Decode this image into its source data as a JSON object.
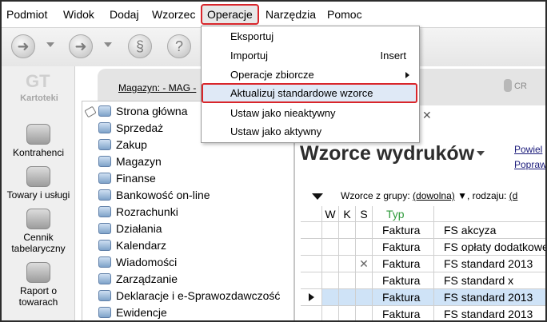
{
  "menubar": [
    "Podmiot",
    "Widok",
    "Dodaj",
    "Wzorzec",
    "Operacje",
    "Narzędzia",
    "Pomoc"
  ],
  "active_menu": "Operacje",
  "operacje_menu": [
    {
      "label": "Eksportuj",
      "shortcut": ""
    },
    {
      "label": "Importuj",
      "shortcut": "Insert"
    },
    {
      "label": "Operacje zbiorcze",
      "shortcut": ""
    },
    {
      "label": "Aktualizuj standardowe wzorce",
      "shortcut": ""
    },
    {
      "label": "Ustaw jako nieaktywny",
      "shortcut": ""
    },
    {
      "label": "Ustaw jako aktywny",
      "shortcut": ""
    }
  ],
  "kartoteki_label": "Kartoteki",
  "left_modules": [
    "Kontrahenci",
    "Towary i usługi",
    "Cennik tabelaryczny",
    "Raport o towarach"
  ],
  "magazyn": "Magazyn: - MAG -",
  "cr_text": "CR",
  "nav_items": [
    "Strona główna",
    "Sprzedaż",
    "Zakup",
    "Magazyn",
    "Finanse",
    "Bankowość on-line",
    "Rozrachunki",
    "Działania",
    "Kalendarz",
    "Wiadomości",
    "Zarządzanie",
    "Deklaracje i e-Sprawozdawczość",
    "Ewidencje"
  ],
  "page_title": "Wzorce wydruków",
  "right_links": [
    "Powiel",
    "Popraw"
  ],
  "filters": {
    "group_label": "Wzorce z grupy:",
    "group_value": "(dowolna)",
    "kind_label": ", rodzaju:",
    "kind_value": "(d"
  },
  "grid_headers": {
    "w": "W",
    "k": "K",
    "s": "S",
    "typ": "Typ"
  },
  "grid_rows": [
    {
      "typ": "Faktura",
      "name": "FS akcyza",
      "s_mark": "",
      "selected": false
    },
    {
      "typ": "Faktura",
      "name": "FS opłaty dodatkowe",
      "s_mark": "",
      "selected": false
    },
    {
      "typ": "Faktura",
      "name": "FS standard 2013",
      "s_mark": "✕",
      "selected": false
    },
    {
      "typ": "Faktura",
      "name": "FS standard x",
      "s_mark": "",
      "selected": false
    },
    {
      "typ": "Faktura",
      "name": "FS standard 2013",
      "s_mark": "",
      "selected": true
    },
    {
      "typ": "Faktura",
      "name": "FS standard 2013",
      "s_mark": "",
      "selected": false
    }
  ],
  "colors": {
    "highlight_border": "#d9262b",
    "typ_header": "#2e9a3a",
    "selection": "#cfe3f7"
  }
}
